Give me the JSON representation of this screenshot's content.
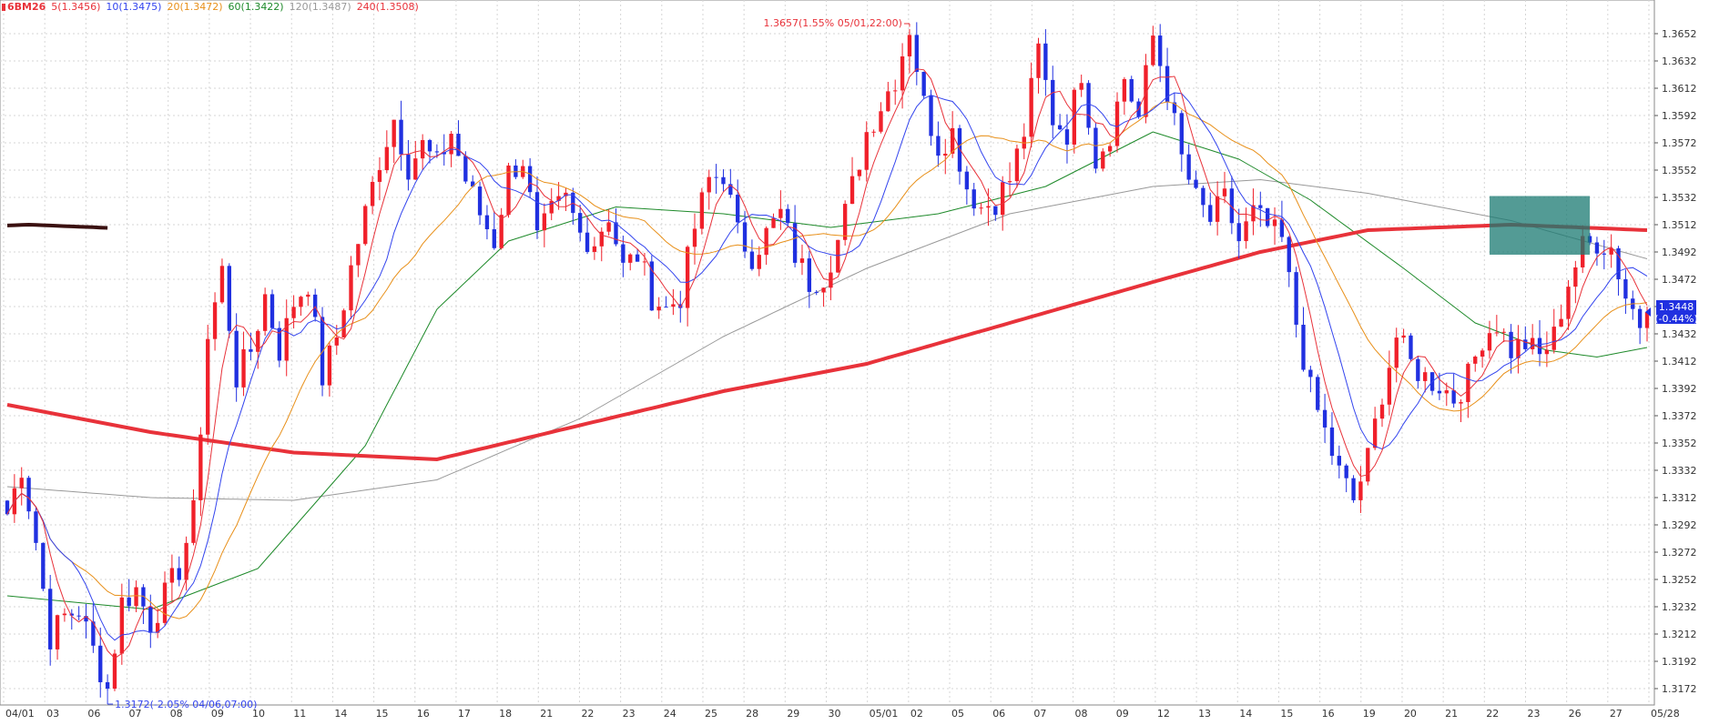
{
  "legend": {
    "symbol": "6BM26",
    "ma5": "5(1.3456)",
    "ma10": "10(1.3475)",
    "ma20": "20(1.3472)",
    "ma60": "60(1.3422)",
    "ma120": "120(1.3487)",
    "ma240": "240(1.3508)",
    "colors": {
      "symbol": "#e8323a",
      "ma5": "#e8323a",
      "ma10": "#3344ee",
      "ma20": "#e8901a",
      "ma60": "#1e8a2a",
      "ma120": "#999999",
      "ma240": "#e8323a"
    }
  },
  "annotations": {
    "high": "1.3657(1.55% 05/01,22:00)",
    "low": "1.3172(-2.05% 04/06,07:00)",
    "last_price": "1.3448",
    "last_change": "(-0.44%)"
  },
  "chart_data": {
    "type": "candlestick",
    "ylim": [
      1.316,
      1.367
    ],
    "yticks": [
      "1.3652",
      "1.3632",
      "1.3612",
      "1.3592",
      "1.3572",
      "1.3552",
      "1.3532",
      "1.3512",
      "1.3492",
      "1.3472",
      "1.3452",
      "1.3432",
      "1.3412",
      "1.3392",
      "1.3372",
      "1.3352",
      "1.3332",
      "1.3312",
      "1.3292",
      "1.3272",
      "1.3252",
      "1.3232",
      "1.3212",
      "1.3192",
      "1.3172"
    ],
    "xticks": [
      "04/01",
      "03",
      "06",
      "07",
      "08",
      "09",
      "10",
      "11",
      "14",
      "15",
      "16",
      "17",
      "18",
      "21",
      "22",
      "23",
      "24",
      "25",
      "28",
      "29",
      "30",
      "05/01",
      "02",
      "05",
      "06",
      "07",
      "08",
      "09",
      "12",
      "13",
      "14",
      "15",
      "16",
      "19",
      "20",
      "21",
      "22",
      "23",
      "26",
      "27",
      "05/28"
    ],
    "price_path": [
      [
        0,
        1.33
      ],
      [
        2,
        1.3335
      ],
      [
        4,
        1.328
      ],
      [
        6,
        1.321
      ],
      [
        8,
        1.3225
      ],
      [
        10,
        1.323
      ],
      [
        12,
        1.32
      ],
      [
        14,
        1.3172
      ],
      [
        16,
        1.3235
      ],
      [
        18,
        1.3245
      ],
      [
        20,
        1.322
      ],
      [
        22,
        1.324
      ],
      [
        24,
        1.326
      ],
      [
        26,
        1.33
      ],
      [
        28,
        1.343
      ],
      [
        30,
        1.3478
      ],
      [
        32,
        1.34
      ],
      [
        34,
        1.342
      ],
      [
        36,
        1.346
      ],
      [
        38,
        1.342
      ],
      [
        40,
        1.3455
      ],
      [
        42,
        1.347
      ],
      [
        44,
        1.34
      ],
      [
        46,
        1.343
      ],
      [
        48,
        1.348
      ],
      [
        50,
        1.352
      ],
      [
        52,
        1.356
      ],
      [
        54,
        1.359
      ],
      [
        56,
        1.3555
      ],
      [
        58,
        1.357
      ],
      [
        60,
        1.3555
      ],
      [
        62,
        1.358
      ],
      [
        64,
        1.3545
      ],
      [
        66,
        1.352
      ],
      [
        68,
        1.35
      ],
      [
        70,
        1.355
      ],
      [
        72,
        1.356
      ],
      [
        74,
        1.35
      ],
      [
        76,
        1.352
      ],
      [
        78,
        1.353
      ],
      [
        80,
        1.3505
      ],
      [
        82,
        1.35
      ],
      [
        84,
        1.352
      ],
      [
        86,
        1.348
      ],
      [
        88,
        1.349
      ],
      [
        90,
        1.346
      ],
      [
        92,
        1.345
      ],
      [
        94,
        1.346
      ],
      [
        96,
        1.351
      ],
      [
        98,
        1.3545
      ],
      [
        100,
        1.355
      ],
      [
        102,
        1.3505
      ],
      [
        104,
        1.349
      ],
      [
        106,
        1.3505
      ],
      [
        108,
        1.352
      ],
      [
        110,
        1.349
      ],
      [
        112,
        1.347
      ],
      [
        114,
        1.3475
      ],
      [
        116,
        1.35
      ],
      [
        118,
        1.354
      ],
      [
        120,
        1.358
      ],
      [
        122,
        1.36
      ],
      [
        124,
        1.362
      ],
      [
        126,
        1.3657
      ],
      [
        128,
        1.36
      ],
      [
        130,
        1.357
      ],
      [
        132,
        1.358
      ],
      [
        134,
        1.354
      ],
      [
        136,
        1.3525
      ],
      [
        138,
        1.353
      ],
      [
        140,
        1.3545
      ],
      [
        142,
        1.358
      ],
      [
        144,
        1.364
      ],
      [
        146,
        1.359
      ],
      [
        148,
        1.358
      ],
      [
        150,
        1.3625
      ],
      [
        152,
        1.356
      ],
      [
        154,
        1.358
      ],
      [
        156,
        1.362
      ],
      [
        158,
        1.359
      ],
      [
        160,
        1.365
      ],
      [
        162,
        1.361
      ],
      [
        164,
        1.356
      ],
      [
        166,
        1.353
      ],
      [
        168,
        1.3515
      ],
      [
        170,
        1.353
      ],
      [
        172,
        1.35
      ],
      [
        174,
        1.352
      ],
      [
        176,
        1.351
      ],
      [
        178,
        1.35
      ],
      [
        180,
        1.344
      ],
      [
        182,
        1.339
      ],
      [
        184,
        1.336
      ],
      [
        186,
        1.333
      ],
      [
        188,
        1.331
      ],
      [
        190,
        1.334
      ],
      [
        192,
        1.339
      ],
      [
        194,
        1.343
      ],
      [
        196,
        1.341
      ],
      [
        198,
        1.34
      ],
      [
        200,
        1.3395
      ],
      [
        202,
        1.3385
      ],
      [
        204,
        1.34
      ],
      [
        206,
        1.343
      ],
      [
        208,
        1.344
      ],
      [
        210,
        1.342
      ],
      [
        212,
        1.3425
      ],
      [
        214,
        1.3415
      ],
      [
        216,
        1.343
      ],
      [
        218,
        1.347
      ],
      [
        220,
        1.3495
      ],
      [
        222,
        1.35
      ],
      [
        224,
        1.3495
      ],
      [
        226,
        1.346
      ],
      [
        228,
        1.344
      ],
      [
        229,
        1.3448
      ]
    ],
    "ma240_path": [
      [
        0,
        1.338
      ],
      [
        20,
        1.336
      ],
      [
        40,
        1.3345
      ],
      [
        60,
        1.334
      ],
      [
        80,
        1.3365
      ],
      [
        100,
        1.339
      ],
      [
        120,
        1.341
      ],
      [
        140,
        1.344
      ],
      [
        160,
        1.347
      ],
      [
        175,
        1.3492
      ],
      [
        190,
        1.3508
      ],
      [
        210,
        1.3512
      ],
      [
        229,
        1.3508
      ]
    ],
    "ma120_path": [
      [
        0,
        1.332
      ],
      [
        20,
        1.3312
      ],
      [
        40,
        1.331
      ],
      [
        60,
        1.3325
      ],
      [
        80,
        1.337
      ],
      [
        100,
        1.343
      ],
      [
        120,
        1.348
      ],
      [
        140,
        1.352
      ],
      [
        160,
        1.354
      ],
      [
        175,
        1.3545
      ],
      [
        190,
        1.3535
      ],
      [
        210,
        1.3515
      ],
      [
        229,
        1.3487
      ]
    ],
    "ma60_path": [
      [
        0,
        1.324
      ],
      [
        20,
        1.323
      ],
      [
        35,
        1.326
      ],
      [
        50,
        1.335
      ],
      [
        60,
        1.345
      ],
      [
        70,
        1.35
      ],
      [
        85,
        1.3525
      ],
      [
        100,
        1.352
      ],
      [
        115,
        1.351
      ],
      [
        130,
        1.352
      ],
      [
        145,
        1.354
      ],
      [
        160,
        1.358
      ],
      [
        172,
        1.356
      ],
      [
        182,
        1.353
      ],
      [
        195,
        1.348
      ],
      [
        205,
        1.344
      ],
      [
        215,
        1.342
      ],
      [
        222,
        1.3415
      ],
      [
        229,
        1.3422
      ]
    ]
  }
}
